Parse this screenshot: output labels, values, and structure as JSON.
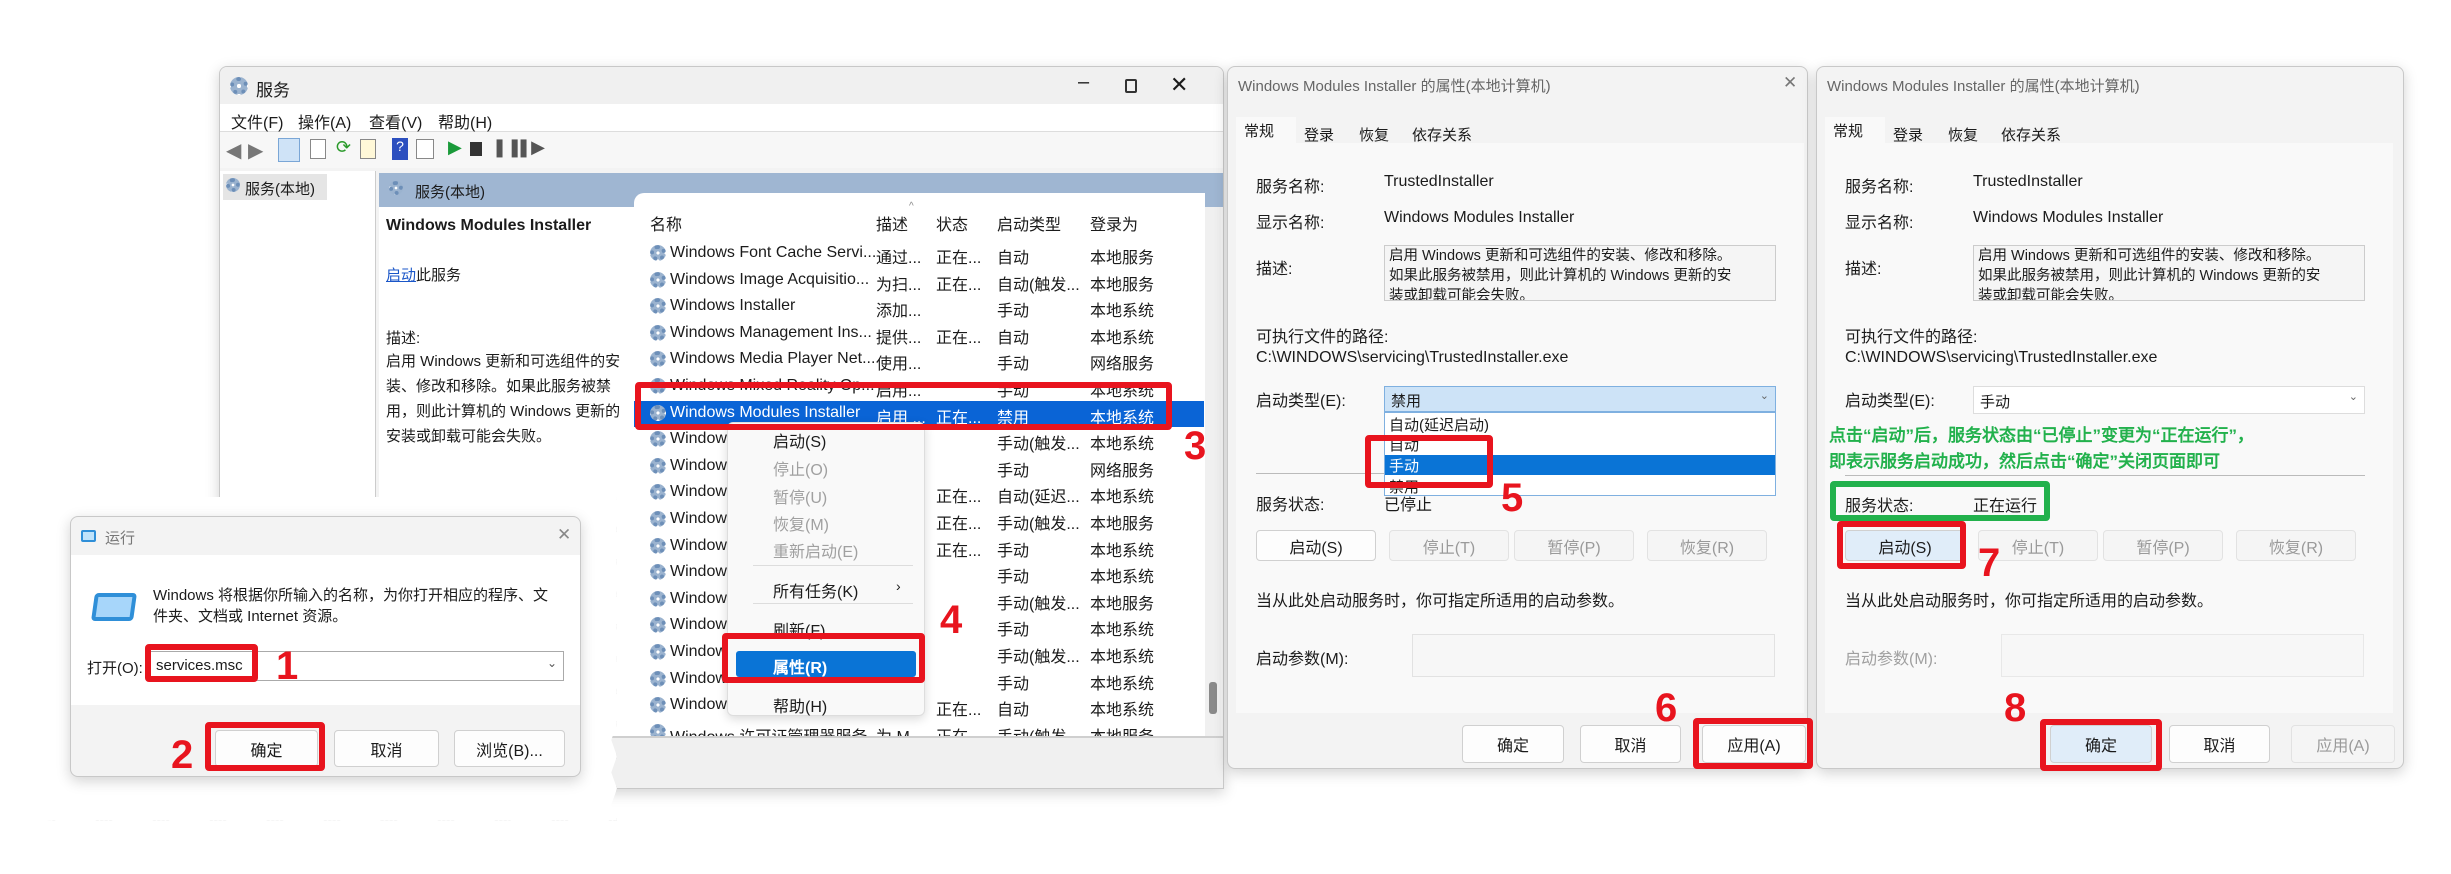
{
  "services_window": {
    "title": "服务",
    "menu": [
      "文件(F)",
      "操作(A)",
      "查看(V)",
      "帮助(H)"
    ],
    "tree_item": "服务(本地)",
    "header": "服务(本地)",
    "detail": {
      "title": "Windows Modules Installer",
      "start_link": "启动",
      "start_suffix": "此服务",
      "desc_label": "描述:",
      "desc_lines": [
        "启用 Windows 更新和可选组件的安",
        "装、修改和移除。如果此服务被禁",
        "用，则此计算机的 Windows 更新的",
        "安装或卸载可能会失败。"
      ]
    },
    "columns": [
      "名称",
      "描述",
      "状态",
      "启动类型",
      "登录为"
    ],
    "rows": [
      [
        "Windows Font Cache Servi...",
        "通过...",
        "正在...",
        "自动",
        "本地服务"
      ],
      [
        "Windows Image Acquisitio...",
        "为扫...",
        "正在...",
        "自动(触发...",
        "本地服务"
      ],
      [
        "Windows Installer",
        "添加...",
        "",
        "手动",
        "本地系统"
      ],
      [
        "Windows Management Ins...",
        "提供...",
        "正在...",
        "自动",
        "本地系统"
      ],
      [
        "Windows Media Player Net...",
        "使用...",
        "",
        "手动",
        "网络服务"
      ],
      [
        "Windows Mixed Reality Op...",
        "启用...",
        "",
        "手动",
        "本地系统"
      ],
      [
        "Windows Modules Installer",
        "启用 ...",
        "正在...",
        "禁用",
        "本地系统"
      ],
      [
        "Window",
        "",
        "",
        "手动(触发...",
        "本地系统"
      ],
      [
        "Window",
        "",
        "",
        "手动",
        "网络服务"
      ],
      [
        "Window",
        "",
        "正在...",
        "自动(延迟...",
        "本地系统"
      ],
      [
        "Window",
        "",
        "正在...",
        "手动(触发...",
        "本地服务"
      ],
      [
        "Window",
        "",
        "正在...",
        "手动",
        "本地系统"
      ],
      [
        "Window",
        "",
        "",
        "手动",
        "本地系统"
      ],
      [
        "Window",
        "",
        "",
        "手动(触发...",
        "本地服务"
      ],
      [
        "Window",
        "",
        "",
        "手动",
        "本地系统"
      ],
      [
        "Window",
        "",
        "",
        "手动(触发...",
        "本地系统"
      ],
      [
        "Window",
        "",
        "",
        "手动",
        "本地系统"
      ],
      [
        "Window",
        "",
        "正在...",
        "自动",
        "本地系统"
      ],
      [
        "Windows 许可证管理器服务",
        "为 M...",
        "正在...",
        "手动(触发...",
        "本地服务"
      ]
    ],
    "selected_row": 6,
    "context_menu": [
      {
        "label": "启动(S)",
        "disabled": false
      },
      {
        "label": "停止(O)",
        "disabled": true
      },
      {
        "label": "暂停(U)",
        "disabled": true
      },
      {
        "label": "恢复(M)",
        "disabled": true
      },
      {
        "label": "重新启动(E)",
        "disabled": true
      },
      {
        "label": "所有任务(K)",
        "disabled": false,
        "submenu": true
      },
      {
        "label": "刷新(F)",
        "disabled": false
      },
      {
        "label": "属性(R)",
        "disabled": false,
        "highlighted": true
      },
      {
        "label": "帮助(H)",
        "disabled": false
      }
    ]
  },
  "run_dialog": {
    "title": "运行",
    "message_lines": [
      "Windows 将根据你所输入的名称，为你打开相应的程序、文",
      "件夹、文档或 Internet 资源。"
    ],
    "open_label": "打开(O):",
    "input_value": "services.msc",
    "ok": "确定",
    "cancel": "取消",
    "browse": "浏览(B)..."
  },
  "props_before": {
    "title": "Windows Modules Installer 的属性(本地计算机)",
    "tabs": [
      "常规",
      "登录",
      "恢复",
      "依存关系"
    ],
    "service_name_label": "服务名称:",
    "service_name": "TrustedInstaller",
    "display_name_label": "显示名称:",
    "display_name": "Windows Modules Installer",
    "desc_label": "描述:",
    "desc_lines": [
      "启用 Windows 更新和可选组件的安装、修改和移除。",
      "如果此服务被禁用，则此计算机的 Windows 更新的安",
      "装或卸载可能会失败。"
    ],
    "path_label": "可执行文件的路径:",
    "path": "C:\\WINDOWS\\servicing\\TrustedInstaller.exe",
    "startup_label": "启动类型(E):",
    "startup_value": "禁用",
    "startup_options": [
      "自动(延迟启动)",
      "自动",
      "手动",
      "禁用"
    ],
    "startup_highlighted": "手动",
    "status_label": "服务状态:",
    "status_value": "已停止",
    "btn_start": "启动(S)",
    "btn_stop": "停止(T)",
    "btn_pause": "暂停(P)",
    "btn_resume": "恢复(R)",
    "hint": "当从此处启动服务时，你可指定所适用的启动参数。",
    "params_label": "启动参数(M):",
    "ok": "确定",
    "cancel": "取消",
    "apply": "应用(A)"
  },
  "props_after": {
    "title": "Windows Modules Installer 的属性(本地计算机)",
    "tabs": [
      "常规",
      "登录",
      "恢复",
      "依存关系"
    ],
    "service_name_label": "服务名称:",
    "service_name": "TrustedInstaller",
    "display_name_label": "显示名称:",
    "display_name": "Windows Modules Installer",
    "desc_label": "描述:",
    "desc_lines": [
      "启用 Windows 更新和可选组件的安装、修改和移除。",
      "如果此服务被禁用，则此计算机的 Windows 更新的安",
      "装或卸载可能会失败。"
    ],
    "path_label": "可执行文件的路径:",
    "path": "C:\\WINDOWS\\servicing\\TrustedInstaller.exe",
    "startup_label": "启动类型(E):",
    "startup_value": "手动",
    "note_lines": [
      "点击“启动”后，服务状态由“已停止”变更为“正在运行”，",
      "即表示服务启动成功，然后点击“确定”关闭页面即可"
    ],
    "status_label": "服务状态:",
    "status_value": "正在运行",
    "btn_start": "启动(S)",
    "btn_stop": "停止(T)",
    "btn_pause": "暂停(P)",
    "btn_resume": "恢复(R)",
    "hint": "当从此处启动服务时，你可指定所适用的启动参数。",
    "params_label": "启动参数(M):",
    "ok": "确定",
    "cancel": "取消",
    "apply": "应用(A)"
  },
  "step_numbers": [
    "1",
    "2",
    "3",
    "4",
    "5",
    "6",
    "7",
    "8"
  ],
  "colors": {
    "annotation_red": "#e8141e",
    "annotation_green": "#22b14c",
    "selection_blue": "#0a64d6"
  }
}
